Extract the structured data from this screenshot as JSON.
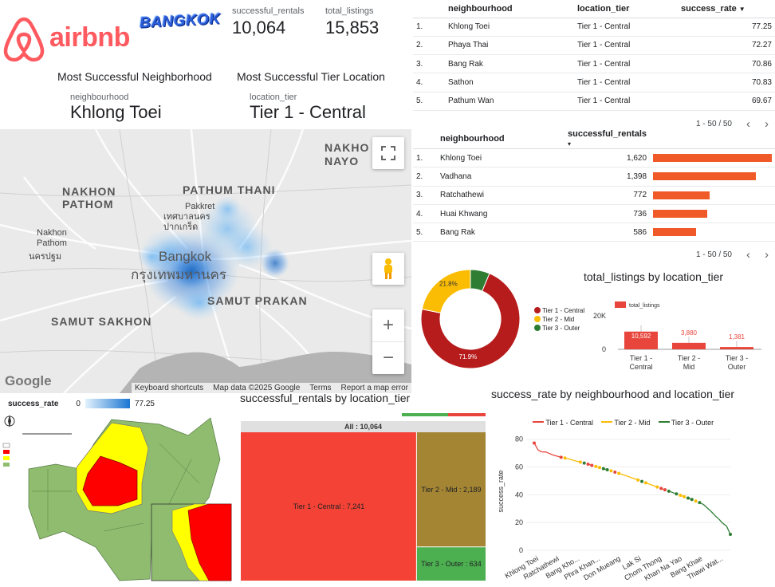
{
  "brand": {
    "logo_text": "airbnb",
    "city_badge": "BANGKOK",
    "logo_color": "#ff5a5f"
  },
  "kpis": [
    {
      "label": "successful_rentals",
      "value": "10,064"
    },
    {
      "label": "total_listings",
      "value": "15,853"
    }
  ],
  "scorecards": [
    {
      "title": "Most Successful Neighborhood",
      "field": "neighbourhood",
      "value": "Khlong Toei"
    },
    {
      "title": "Most Successful Tier Location",
      "field": "location_tier",
      "value": "Tier 1 - Central"
    }
  ],
  "rate_table": {
    "columns": [
      "neighbourhood",
      "location_tier",
      "success_rate"
    ],
    "sort_icon": "▼",
    "rows": [
      {
        "idx": "1.",
        "neighbourhood": "Khlong Toei",
        "tier": "Tier 1 - Central",
        "rate": "77.25"
      },
      {
        "idx": "2.",
        "neighbourhood": "Phaya Thai",
        "tier": "Tier 1 - Central",
        "rate": "72.27"
      },
      {
        "idx": "3.",
        "neighbourhood": "Bang Rak",
        "tier": "Tier 1 - Central",
        "rate": "70.86"
      },
      {
        "idx": "4.",
        "neighbourhood": "Sathon",
        "tier": "Tier 1 - Central",
        "rate": "70.83"
      },
      {
        "idx": "5.",
        "neighbourhood": "Pathum Wan",
        "tier": "Tier 1 - Central",
        "rate": "69.67"
      }
    ],
    "pagination": "1 - 50 / 50"
  },
  "rentals_table": {
    "columns": [
      "neighbourhood",
      "successful_rentals"
    ],
    "sort_icon": "▾",
    "bar_color": "#f05a28",
    "rows": [
      {
        "idx": "1.",
        "neighbourhood": "Khlong Toei",
        "value": "1,620",
        "n": 1620
      },
      {
        "idx": "2.",
        "neighbourhood": "Vadhana",
        "value": "1,398",
        "n": 1398
      },
      {
        "idx": "3.",
        "neighbourhood": "Ratchathewi",
        "value": "772",
        "n": 772
      },
      {
        "idx": "4.",
        "neighbourhood": "Huai Khwang",
        "value": "736",
        "n": 736
      },
      {
        "idx": "5.",
        "neighbourhood": "Bang Rak",
        "value": "586",
        "n": 586
      }
    ],
    "pagination": "1 - 50 / 50"
  },
  "map": {
    "labels": [
      "NAKHON PATHOM",
      "PATHUM THANI",
      "NAKHO NAYO",
      "Nakhon Pathom",
      "นครปฐม",
      "Pakkret",
      "เทศบาลนคร ปากเกร็ด",
      "Bangkok",
      "กรุงเทพมหานคร",
      "SAMUT PRAKAN",
      "SAMUT SAKHON"
    ],
    "footer": [
      "Keyboard shortcuts",
      "Map data ©2025 Google",
      "Terms",
      "Report a map error"
    ],
    "google": "Google",
    "legend_title": "success_rate",
    "legend_min": "0",
    "legend_max": "77.25"
  },
  "donut": {
    "labels": [
      "Tier 1 - Central",
      "Tier 2 - Mid",
      "Tier 3 - Outer"
    ],
    "pct_labels": [
      "71.9%",
      "21.8%"
    ],
    "colors": [
      "#b71c1c",
      "#fbbc04",
      "#2e7d32"
    ]
  },
  "chart_data": [
    {
      "type": "pie",
      "categories": [
        "Tier 1 - Central",
        "Tier 2 - Mid",
        "Tier 3 - Outer"
      ],
      "values": [
        71.9,
        21.8,
        6.3
      ],
      "labels": [
        "71.9%",
        "21.8%"
      ]
    },
    {
      "type": "bar",
      "title": "total_listings by location_tier",
      "categories": [
        "Tier 1 - Central",
        "Tier 2 - Mid",
        "Tier 3 - Outer"
      ],
      "series": [
        {
          "name": "total_listings",
          "values": [
            10592,
            3880,
            1381
          ]
        }
      ],
      "value_labels": [
        "10,592",
        "3,880",
        "1,381"
      ],
      "ytick_label": "20K",
      "yzero_label": "0",
      "ylim": [
        0,
        20000
      ]
    },
    {
      "type": "heatmap",
      "title": "successful_rentals by location_tier",
      "root_label": "All : 10,064",
      "categories": [
        "Tier 1 - Central",
        "Tier 2 - Mid",
        "Tier 3 - Outer"
      ],
      "values": [
        7241,
        2189,
        634
      ],
      "labels": [
        "Tier 1 - Central : 7,241",
        "Tier 2 - Mid : 2,189",
        "Tier 3 - Outer : 634"
      ]
    },
    {
      "type": "line",
      "title": "success_rate by neighbourhood and location_tier",
      "ylabel": "success_rate",
      "yticks": [
        "0",
        "20",
        "40",
        "60",
        "80"
      ],
      "ylim": [
        0,
        85
      ],
      "xtick_labels": [
        "Khlong Toei",
        "Ratchathewi",
        "Bang Kho...",
        "Phra Khan...",
        "Don Mueang",
        "Lak Si",
        "Chom Thong",
        "Khan Na Yao",
        "Bang Khae",
        "Thawi Wat..."
      ],
      "series_names": [
        "Tier 1 - Central",
        "Tier 2 - Mid",
        "Tier 3 - Outer"
      ],
      "colors": [
        "#e8453c",
        "#fbbc04",
        "#2e7d32"
      ],
      "points": [
        [
          77.25,
          0
        ],
        [
          72.27,
          0
        ],
        [
          70.86,
          0
        ],
        [
          70.83,
          0
        ],
        [
          69.67,
          0
        ],
        [
          68.5,
          0
        ],
        [
          67.8,
          0
        ],
        [
          67.0,
          0
        ],
        [
          66.5,
          1
        ],
        [
          65.8,
          1
        ],
        [
          65.0,
          1
        ],
        [
          64.2,
          1
        ],
        [
          63.5,
          1
        ],
        [
          62.8,
          2
        ],
        [
          62.0,
          0
        ],
        [
          61.2,
          0
        ],
        [
          60.4,
          1
        ],
        [
          59.6,
          1
        ],
        [
          58.8,
          2
        ],
        [
          58.0,
          2
        ],
        [
          57.2,
          1
        ],
        [
          56.3,
          0
        ],
        [
          55.4,
          1
        ],
        [
          54.5,
          1
        ],
        [
          53.6,
          1
        ],
        [
          52.6,
          1
        ],
        [
          51.6,
          1
        ],
        [
          50.6,
          1
        ],
        [
          49.6,
          2
        ],
        [
          48.6,
          1
        ],
        [
          47.6,
          1
        ],
        [
          46.6,
          1
        ],
        [
          45.6,
          1
        ],
        [
          44.6,
          0
        ],
        [
          43.6,
          0
        ],
        [
          42.6,
          2
        ],
        [
          41.6,
          2
        ],
        [
          40.6,
          2
        ],
        [
          39.6,
          1
        ],
        [
          38.6,
          1
        ],
        [
          37.6,
          2
        ],
        [
          36.6,
          2
        ],
        [
          35.5,
          1
        ],
        [
          34.4,
          2
        ],
        [
          33.0,
          2
        ],
        [
          30.5,
          2
        ],
        [
          28.0,
          2
        ],
        [
          25.0,
          2
        ],
        [
          22.5,
          2
        ],
        [
          19.5,
          2
        ],
        [
          17.5,
          2
        ],
        [
          11.5,
          2
        ]
      ]
    }
  ],
  "colors": {
    "accent": "#1a73e8",
    "table_bar": "#f05a28"
  }
}
